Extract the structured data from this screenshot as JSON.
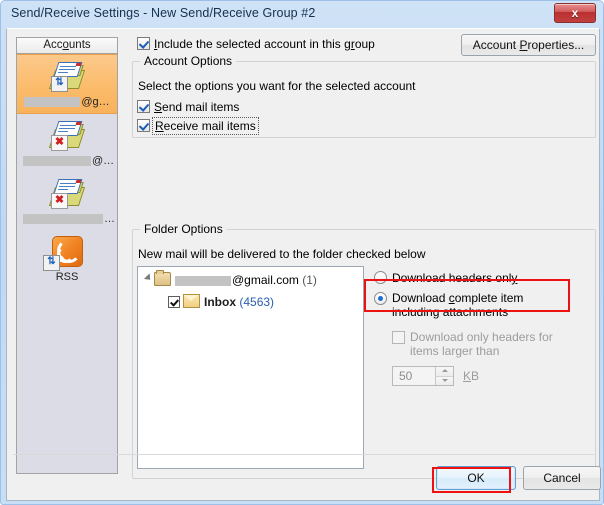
{
  "window": {
    "title": "Send/Receive Settings - New Send/Receive Group #2",
    "close_label": "x"
  },
  "sidebar": {
    "header": "Accounts",
    "items": [
      {
        "label": "@g…",
        "icon": "mail-account-sync-icon",
        "selected": true,
        "redacted": true
      },
      {
        "label": "@…",
        "icon": "mail-account-error-icon",
        "selected": false,
        "redacted": true
      },
      {
        "label": "…",
        "icon": "mail-account-error-icon",
        "selected": false,
        "redacted": true
      },
      {
        "label": "RSS",
        "icon": "rss-feed-icon",
        "selected": false,
        "redacted": false
      }
    ]
  },
  "main": {
    "include_account": {
      "label": "Include the selected account in this group",
      "checked": true
    },
    "account_properties_button": "Account Properties...",
    "account_options": {
      "title": "Account Options",
      "description": "Select the options you want for the selected account",
      "send_mail": {
        "label": "Send mail items",
        "checked": true
      },
      "receive_mail": {
        "label": "Receive mail items",
        "checked": true,
        "focused": true
      }
    },
    "folder_options": {
      "title": "Folder Options",
      "description": "New mail will be delivered to the folder checked below",
      "tree": {
        "account_node": {
          "label": "@gmail.com",
          "count": "(1)",
          "expanded": true,
          "redacted": true
        },
        "inbox_node": {
          "label": "Inbox",
          "count": "(4563)",
          "checked": true
        }
      },
      "download_headers_only": {
        "label": "Download headers only",
        "selected": false
      },
      "download_complete_item": {
        "label": "Download complete item including attachments",
        "selected": true,
        "highlighted": true
      },
      "download_only_headers_larger": {
        "label": "Download only headers for items larger than",
        "checked": false,
        "disabled": true
      },
      "size_value": "50",
      "size_unit": "KB"
    }
  },
  "footer": {
    "ok_button": "OK",
    "cancel_button": "Cancel"
  },
  "colors": {
    "accent_selected": "#f8b25b",
    "annotation": "#ee1111",
    "link_count": "#2a5db0",
    "title_text": "#14314f"
  }
}
